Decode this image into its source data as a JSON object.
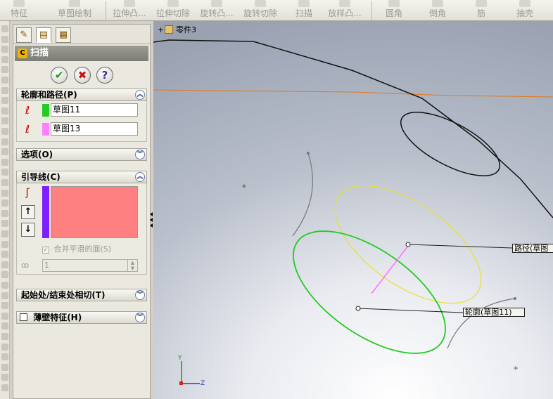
{
  "toolbar": {
    "items": [
      {
        "label": "特征",
        "icon": "feature-icon"
      },
      {
        "label": "草图绘制",
        "icon": "sketch-icon"
      },
      {
        "label": "拉伸凸...",
        "icon": "extrude-boss-icon"
      },
      {
        "label": "拉伸切除",
        "icon": "extrude-cut-icon"
      },
      {
        "label": "旋转凸...",
        "icon": "revolve-boss-icon"
      },
      {
        "label": "旋转切除",
        "icon": "revolve-cut-icon"
      },
      {
        "label": "扫描",
        "icon": "sweep-icon"
      },
      {
        "label": "放样凸...",
        "icon": "loft-boss-icon"
      },
      {
        "label": "圆角",
        "icon": "fillet-icon"
      },
      {
        "label": "倒角",
        "icon": "chamfer-icon"
      },
      {
        "label": "筋",
        "icon": "rib-icon"
      },
      {
        "label": "抽壳",
        "icon": "shell-icon"
      }
    ]
  },
  "property_manager": {
    "title": "扫描",
    "buttons": {
      "ok": "✔",
      "cancel": "✖",
      "help": "?"
    },
    "profile_path": {
      "header": "轮廓和路径(P)",
      "profile_value": "草图11",
      "profile_color": "#22cc22",
      "path_value": "草图13",
      "path_color": "#ff80ff"
    },
    "options": {
      "header": "选项(O)"
    },
    "guide_curves": {
      "header": "引导线(C)",
      "list_color": "#ff8080",
      "merge_smooth_label": "合并平滑的面(S)",
      "merge_smooth_checked": true,
      "value": "1"
    },
    "start_end_tangency": {
      "header": "起始处/结束处相切(T)"
    },
    "thin_feature": {
      "header": "薄壁特征(H)",
      "checked": false
    }
  },
  "viewport": {
    "tree_label": "零件3",
    "path_callout": "路径(草图",
    "profile_callout": "轮廓(草图11)",
    "triad": {
      "y": "Y",
      "z": "Z"
    }
  }
}
